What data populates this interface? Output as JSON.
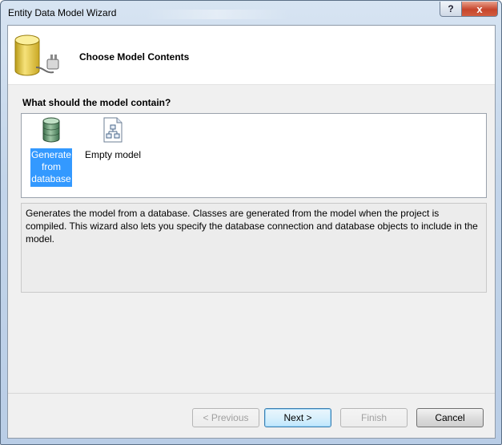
{
  "window": {
    "title": "Entity Data Model Wizard",
    "help_label": "?",
    "close_label": "x"
  },
  "header": {
    "title": "Choose Model Contents"
  },
  "question": "What should the model contain?",
  "choices": [
    {
      "line1": "Generate",
      "line2": "from",
      "line3": "database",
      "selected": true
    },
    {
      "label": "Empty model",
      "selected": false
    }
  ],
  "description": "Generates the model from a database. Classes are generated from the model when the project is compiled. This wizard also lets you specify the database connection and database objects to include in the model.",
  "buttons": {
    "previous": "< Previous",
    "next": "Next >",
    "finish": "Finish",
    "cancel": "Cancel"
  },
  "colors": {
    "selection": "#3399ff",
    "title_bar": "#c3d5ea",
    "close_button": "#c6452c"
  }
}
